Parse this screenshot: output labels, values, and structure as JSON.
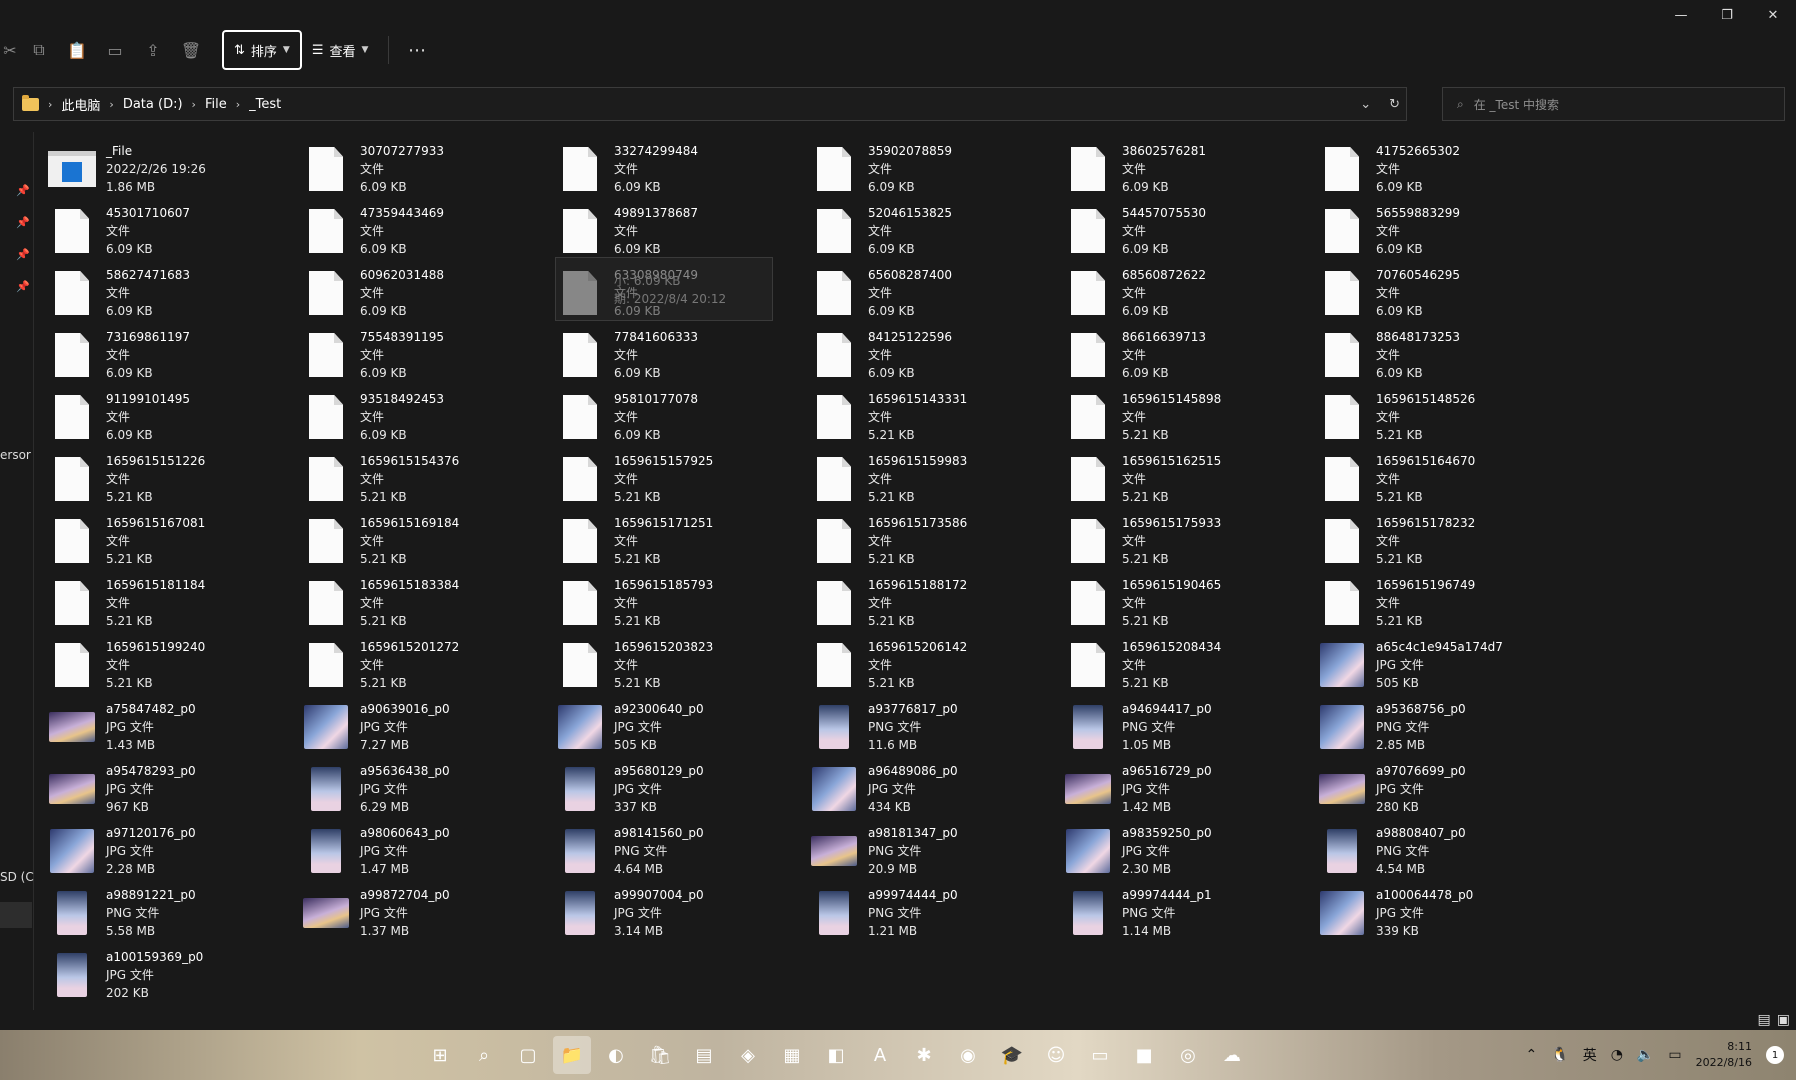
{
  "window_controls": [
    "—",
    "❐",
    "✕"
  ],
  "toolbar": {
    "cut_icon": "scissors-icon",
    "sort_label": "排序",
    "view_label": "查看",
    "more_label": "⋯"
  },
  "address": {
    "crumbs": [
      "此电脑",
      "Data (D:)",
      "File",
      "_Test"
    ]
  },
  "search": {
    "placeholder": "在 _Test 中搜索"
  },
  "nav": {
    "partial_label_1": "ersor",
    "partial_label_2": "SD (C"
  },
  "files": [
    {
      "name": "_File",
      "l2": "2022/2/26 19:26",
      "l3": "1.86 MB",
      "kind": "exe"
    },
    {
      "name": "30707277933",
      "l2": "文件",
      "l3": "6.09 KB",
      "kind": "doc"
    },
    {
      "name": "33274299484",
      "l2": "文件",
      "l3": "6.09 KB",
      "kind": "doc"
    },
    {
      "name": "35902078859",
      "l2": "文件",
      "l3": "6.09 KB",
      "kind": "doc"
    },
    {
      "name": "38602576281",
      "l2": "文件",
      "l3": "6.09 KB",
      "kind": "doc"
    },
    {
      "name": "41752665302",
      "l2": "文件",
      "l3": "6.09 KB",
      "kind": "doc"
    },
    {
      "name": "45301710607",
      "l2": "文件",
      "l3": "6.09 KB",
      "kind": "doc"
    },
    {
      "name": "47359443469",
      "l2": "文件",
      "l3": "6.09 KB",
      "kind": "doc"
    },
    {
      "name": "49891378687",
      "l2": "文件",
      "l3": "6.09 KB",
      "kind": "doc"
    },
    {
      "name": "52046153825",
      "l2": "文件",
      "l3": "6.09 KB",
      "kind": "doc"
    },
    {
      "name": "54457075530",
      "l2": "文件",
      "l3": "6.09 KB",
      "kind": "doc"
    },
    {
      "name": "56559883299",
      "l2": "文件",
      "l3": "6.09 KB",
      "kind": "doc"
    },
    {
      "name": "58627471683",
      "l2": "文件",
      "l3": "6.09 KB",
      "kind": "doc"
    },
    {
      "name": "60962031488",
      "l2": "文件",
      "l3": "6.09 KB",
      "kind": "doc"
    },
    {
      "name": "63308980749",
      "l2": "文件",
      "l3": "6.09 KB",
      "kind": "doc"
    },
    {
      "name": "65608287400",
      "l2": "文件",
      "l3": "6.09 KB",
      "kind": "doc"
    },
    {
      "name": "68560872622",
      "l2": "文件",
      "l3": "6.09 KB",
      "kind": "doc"
    },
    {
      "name": "70760546295",
      "l2": "文件",
      "l3": "6.09 KB",
      "kind": "doc"
    },
    {
      "name": "73169861197",
      "l2": "文件",
      "l3": "6.09 KB",
      "kind": "doc"
    },
    {
      "name": "75548391195",
      "l2": "文件",
      "l3": "6.09 KB",
      "kind": "doc"
    },
    {
      "name": "77841606333",
      "l2": "文件",
      "l3": "6.09 KB",
      "kind": "doc"
    },
    {
      "name": "84125122596",
      "l2": "文件",
      "l3": "6.09 KB",
      "kind": "doc"
    },
    {
      "name": "86616639713",
      "l2": "文件",
      "l3": "6.09 KB",
      "kind": "doc"
    },
    {
      "name": "88648173253",
      "l2": "文件",
      "l3": "6.09 KB",
      "kind": "doc"
    },
    {
      "name": "91199101495",
      "l2": "文件",
      "l3": "6.09 KB",
      "kind": "doc"
    },
    {
      "name": "93518492453",
      "l2": "文件",
      "l3": "6.09 KB",
      "kind": "doc"
    },
    {
      "name": "95810177078",
      "l2": "文件",
      "l3": "6.09 KB",
      "kind": "doc"
    },
    {
      "name": "1659615143331",
      "l2": "文件",
      "l3": "5.21 KB",
      "kind": "doc"
    },
    {
      "name": "1659615145898",
      "l2": "文件",
      "l3": "5.21 KB",
      "kind": "doc"
    },
    {
      "name": "1659615148526",
      "l2": "文件",
      "l3": "5.21 KB",
      "kind": "doc"
    },
    {
      "name": "1659615151226",
      "l2": "文件",
      "l3": "5.21 KB",
      "kind": "doc"
    },
    {
      "name": "1659615154376",
      "l2": "文件",
      "l3": "5.21 KB",
      "kind": "doc"
    },
    {
      "name": "1659615157925",
      "l2": "文件",
      "l3": "5.21 KB",
      "kind": "doc"
    },
    {
      "name": "1659615159983",
      "l2": "文件",
      "l3": "5.21 KB",
      "kind": "doc"
    },
    {
      "name": "1659615162515",
      "l2": "文件",
      "l3": "5.21 KB",
      "kind": "doc"
    },
    {
      "name": "1659615164670",
      "l2": "文件",
      "l3": "5.21 KB",
      "kind": "doc"
    },
    {
      "name": "1659615167081",
      "l2": "文件",
      "l3": "5.21 KB",
      "kind": "doc"
    },
    {
      "name": "1659615169184",
      "l2": "文件",
      "l3": "5.21 KB",
      "kind": "doc"
    },
    {
      "name": "1659615171251",
      "l2": "文件",
      "l3": "5.21 KB",
      "kind": "doc"
    },
    {
      "name": "1659615173586",
      "l2": "文件",
      "l3": "5.21 KB",
      "kind": "doc"
    },
    {
      "name": "1659615175933",
      "l2": "文件",
      "l3": "5.21 KB",
      "kind": "doc"
    },
    {
      "name": "1659615178232",
      "l2": "文件",
      "l3": "5.21 KB",
      "kind": "doc"
    },
    {
      "name": "1659615181184",
      "l2": "文件",
      "l3": "5.21 KB",
      "kind": "doc"
    },
    {
      "name": "1659615183384",
      "l2": "文件",
      "l3": "5.21 KB",
      "kind": "doc"
    },
    {
      "name": "1659615185793",
      "l2": "文件",
      "l3": "5.21 KB",
      "kind": "doc"
    },
    {
      "name": "1659615188172",
      "l2": "文件",
      "l3": "5.21 KB",
      "kind": "doc"
    },
    {
      "name": "1659615190465",
      "l2": "文件",
      "l3": "5.21 KB",
      "kind": "doc"
    },
    {
      "name": "1659615196749",
      "l2": "文件",
      "l3": "5.21 KB",
      "kind": "doc"
    },
    {
      "name": "1659615199240",
      "l2": "文件",
      "l3": "5.21 KB",
      "kind": "doc"
    },
    {
      "name": "1659615201272",
      "l2": "文件",
      "l3": "5.21 KB",
      "kind": "doc"
    },
    {
      "name": "1659615203823",
      "l2": "文件",
      "l3": "5.21 KB",
      "kind": "doc"
    },
    {
      "name": "1659615206142",
      "l2": "文件",
      "l3": "5.21 KB",
      "kind": "doc"
    },
    {
      "name": "1659615208434",
      "l2": "文件",
      "l3": "5.21 KB",
      "kind": "doc"
    },
    {
      "name": "a65c4c1e945a174d7",
      "l2": "JPG 文件",
      "l3": "505 KB",
      "kind": "img"
    },
    {
      "name": "a75847482_p0",
      "l2": "JPG 文件",
      "l3": "1.43 MB",
      "kind": "wide"
    },
    {
      "name": "a90639016_p0",
      "l2": "JPG 文件",
      "l3": "7.27 MB",
      "kind": "img"
    },
    {
      "name": "a92300640_p0",
      "l2": "JPG 文件",
      "l3": "505 KB",
      "kind": "img"
    },
    {
      "name": "a93776817_p0",
      "l2": "PNG 文件",
      "l3": "11.6 MB",
      "kind": "tall"
    },
    {
      "name": "a94694417_p0",
      "l2": "PNG 文件",
      "l3": "1.05 MB",
      "kind": "tall"
    },
    {
      "name": "a95368756_p0",
      "l2": "PNG 文件",
      "l3": "2.85 MB",
      "kind": "img"
    },
    {
      "name": "a95478293_p0",
      "l2": "JPG 文件",
      "l3": "967 KB",
      "kind": "wide"
    },
    {
      "name": "a95636438_p0",
      "l2": "JPG 文件",
      "l3": "6.29 MB",
      "kind": "tall"
    },
    {
      "name": "a95680129_p0",
      "l2": "JPG 文件",
      "l3": "337 KB",
      "kind": "tall"
    },
    {
      "name": "a96489086_p0",
      "l2": "JPG 文件",
      "l3": "434 KB",
      "kind": "img"
    },
    {
      "name": "a96516729_p0",
      "l2": "JPG 文件",
      "l3": "1.42 MB",
      "kind": "wide"
    },
    {
      "name": "a97076699_p0",
      "l2": "JPG 文件",
      "l3": "280 KB",
      "kind": "wide"
    },
    {
      "name": "a97120176_p0",
      "l2": "JPG 文件",
      "l3": "2.28 MB",
      "kind": "img"
    },
    {
      "name": "a98060643_p0",
      "l2": "JPG 文件",
      "l3": "1.47 MB",
      "kind": "tall"
    },
    {
      "name": "a98141560_p0",
      "l2": "PNG 文件",
      "l3": "4.64 MB",
      "kind": "tall"
    },
    {
      "name": "a98181347_p0",
      "l2": "PNG 文件",
      "l3": "20.9 MB",
      "kind": "wide"
    },
    {
      "name": "a98359250_p0",
      "l2": "JPG 文件",
      "l3": "2.30 MB",
      "kind": "img"
    },
    {
      "name": "a98808407_p0",
      "l2": "PNG 文件",
      "l3": "4.54 MB",
      "kind": "tall"
    },
    {
      "name": "a98891221_p0",
      "l2": "PNG 文件",
      "l3": "5.58 MB",
      "kind": "tall"
    },
    {
      "name": "a99872704_p0",
      "l2": "JPG 文件",
      "l3": "1.37 MB",
      "kind": "wide"
    },
    {
      "name": "a99907004_p0",
      "l2": "JPG 文件",
      "l3": "3.14 MB",
      "kind": "tall"
    },
    {
      "name": "a99974444_p0",
      "l2": "PNG 文件",
      "l3": "1.21 MB",
      "kind": "tall"
    },
    {
      "name": "a99974444_p1",
      "l2": "PNG 文件",
      "l3": "1.14 MB",
      "kind": "tall"
    },
    {
      "name": "a100064478_p0",
      "l2": "JPG 文件",
      "l3": "339 KB",
      "kind": "img"
    },
    {
      "name": "a100159369_p0",
      "l2": "JPG 文件",
      "l3": "202 KB",
      "kind": "tall"
    }
  ],
  "tooltip": {
    "line1": "小: 6.09 KB",
    "line2": "期: 2022/8/4 20:12"
  },
  "taskbar": {
    "apps": [
      "start-icon",
      "search-icon",
      "task-view-icon",
      "file-explorer-icon",
      "edge-icon",
      "store-icon",
      "devtools-icon",
      "vscode-icon",
      "app-icon",
      "office-icon",
      "text-editor-icon",
      "dev-app-icon",
      "github-icon",
      "graduation-app-icon",
      "character-app-icon",
      "screen-app-icon",
      "red-app-icon",
      "cyan-app-icon",
      "cloud-app-icon"
    ],
    "ime": "英",
    "time": "8:11",
    "date": "2022/8/16",
    "notifications": "1"
  }
}
